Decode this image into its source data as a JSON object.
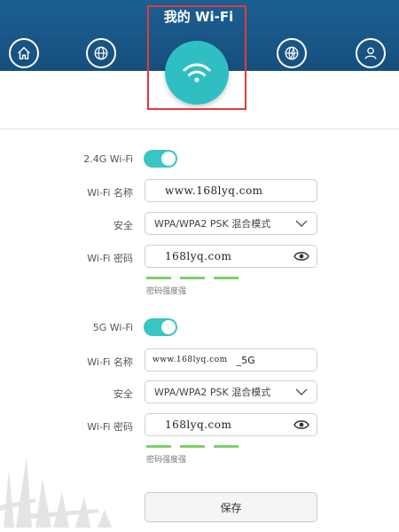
{
  "header": {
    "title": "我的 Wi-Fi",
    "nav_icons": [
      "home-icon",
      "globe-icon",
      "wifi-icon",
      "network-globe-icon",
      "user-icon"
    ],
    "band_color": "#174f7d",
    "accent_color": "#2fbfc3",
    "highlight_color": "#e03b3b"
  },
  "wifi24": {
    "label": "2.4G Wi-Fi",
    "enabled": true,
    "name_label": "Wi-Fi 名称",
    "name_value": "www.168lyq.com",
    "security_label": "安全",
    "security_value": "WPA/WPA2 PSK 混合模式",
    "password_label": "Wi-Fi 密码",
    "password_value": "168lyq.com",
    "strength_text": "密码强度强"
  },
  "wifi5": {
    "label": "5G Wi-Fi",
    "enabled": true,
    "name_label": "Wi-Fi 名称",
    "name_value": "www.168lyq.com",
    "name_suffix": "_5G",
    "security_label": "安全",
    "security_value": "WPA/WPA2 PSK 混合模式",
    "password_label": "Wi-Fi 密码",
    "password_value": "168lyq.com",
    "strength_text": "密码强度强"
  },
  "actions": {
    "save_label": "保存"
  }
}
